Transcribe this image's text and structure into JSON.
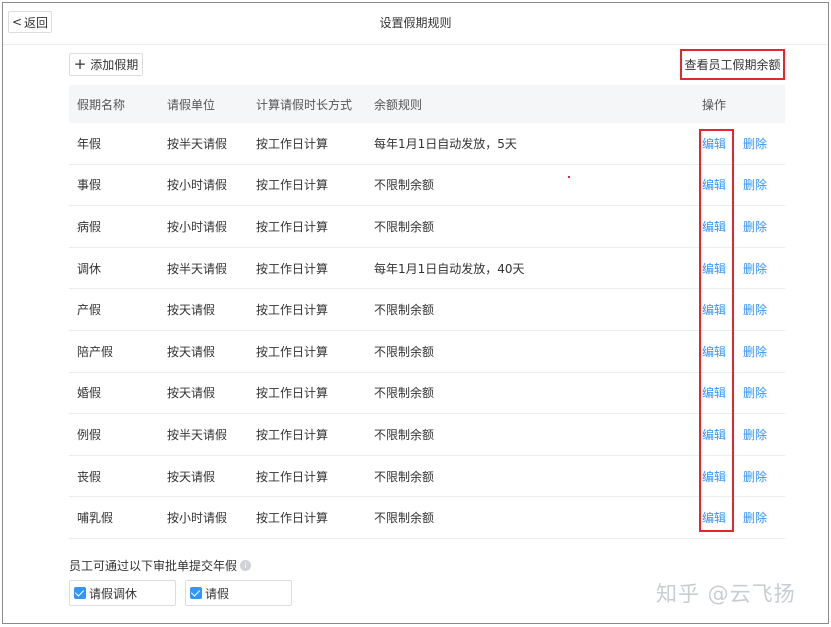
{
  "header": {
    "back_label": "返回",
    "back_icon": "chevron-left-icon",
    "title": "设置假期规则"
  },
  "toolbar": {
    "add_label": "添加假期",
    "view_balance_label": "查看员工假期余额"
  },
  "table": {
    "columns": [
      "假期名称",
      "请假单位",
      "计算请假时长方式",
      "余额规则",
      "操作"
    ],
    "rows": [
      {
        "name": "年假",
        "unit": "按半天请假",
        "method": "按工作日计算",
        "rule": "每年1月1日自动发放，5天",
        "edit": "编辑",
        "delete": "删除"
      },
      {
        "name": "事假",
        "unit": "按小时请假",
        "method": "按工作日计算",
        "rule": "不限制余额",
        "edit": "编辑",
        "delete": "删除"
      },
      {
        "name": "病假",
        "unit": "按小时请假",
        "method": "按工作日计算",
        "rule": "不限制余额",
        "edit": "编辑",
        "delete": "删除"
      },
      {
        "name": "调休",
        "unit": "按半天请假",
        "method": "按工作日计算",
        "rule": "每年1月1日自动发放，40天",
        "edit": "编辑",
        "delete": "删除"
      },
      {
        "name": "产假",
        "unit": "按天请假",
        "method": "按工作日计算",
        "rule": "不限制余额",
        "edit": "编辑",
        "delete": "删除"
      },
      {
        "name": "陪产假",
        "unit": "按天请假",
        "method": "按工作日计算",
        "rule": "不限制余额",
        "edit": "编辑",
        "delete": "删除"
      },
      {
        "name": "婚假",
        "unit": "按天请假",
        "method": "按工作日计算",
        "rule": "不限制余额",
        "edit": "编辑",
        "delete": "删除"
      },
      {
        "name": "例假",
        "unit": "按半天请假",
        "method": "按工作日计算",
        "rule": "不限制余额",
        "edit": "编辑",
        "delete": "删除"
      },
      {
        "name": "丧假",
        "unit": "按天请假",
        "method": "按工作日计算",
        "rule": "不限制余额",
        "edit": "编辑",
        "delete": "删除"
      },
      {
        "name": "哺乳假",
        "unit": "按小时请假",
        "method": "按工作日计算",
        "rule": "不限制余额",
        "edit": "编辑",
        "delete": "删除"
      }
    ]
  },
  "approval": {
    "text": "员工可通过以下审批单提交年假",
    "options": [
      {
        "label": "请假调休",
        "checked": true
      },
      {
        "label": "请假",
        "checked": true
      }
    ]
  },
  "watermark": "知乎 @云飞扬",
  "colors": {
    "link": "#3296fa",
    "highlight": "#e0282e",
    "header_bg": "#f5f6f8"
  }
}
